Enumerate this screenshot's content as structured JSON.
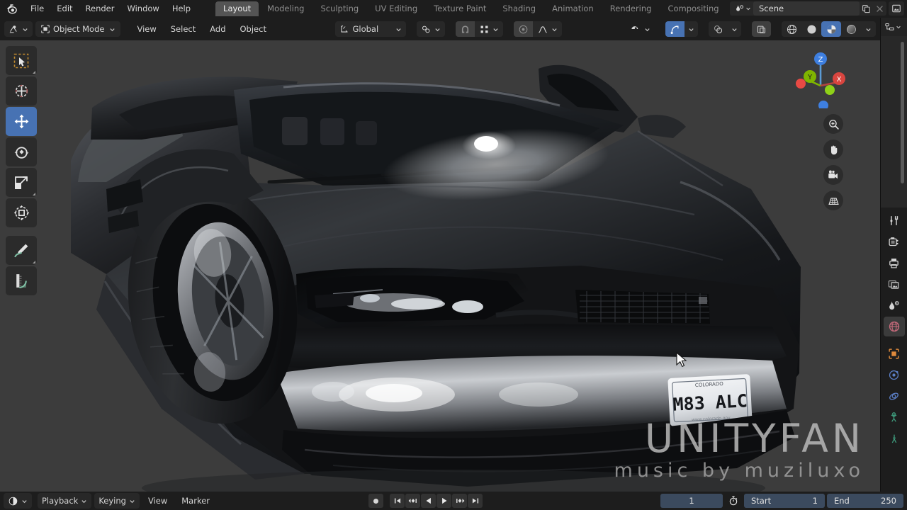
{
  "app": {
    "title": "Blender",
    "logo_icon": "blender-logo-icon"
  },
  "topbar": {
    "menus": [
      {
        "label": "File"
      },
      {
        "label": "Edit"
      },
      {
        "label": "Render"
      },
      {
        "label": "Window"
      },
      {
        "label": "Help"
      }
    ],
    "workspace_tabs": [
      {
        "label": "Layout",
        "active": true
      },
      {
        "label": "Modeling",
        "active": false
      },
      {
        "label": "Sculpting",
        "active": false
      },
      {
        "label": "UV Editing",
        "active": false
      },
      {
        "label": "Texture Paint",
        "active": false
      },
      {
        "label": "Shading",
        "active": false
      },
      {
        "label": "Animation",
        "active": false
      },
      {
        "label": "Rendering",
        "active": false
      },
      {
        "label": "Compositing",
        "active": false
      }
    ],
    "scene": {
      "browse_icon": "scene-browse-icon",
      "name": "Scene",
      "new_icon": "duplicate-icon",
      "unlink_icon": "close-icon",
      "viewlayer_icon": "view-layer-icon"
    }
  },
  "viewport_header": {
    "editor_type_icon": "editor-type-icon",
    "mode": {
      "icon": "object-mode-icon",
      "label": "Object Mode",
      "caret": "chevron-down-icon"
    },
    "menus": [
      {
        "label": "View"
      },
      {
        "label": "Select"
      },
      {
        "label": "Add"
      },
      {
        "label": "Object"
      }
    ],
    "transform_orientation": {
      "icon": "orientation-icon",
      "label": "Global",
      "caret": "chevron-down-icon"
    },
    "pivot": {
      "icon": "pivot-icon",
      "caret": "chevron-down-icon"
    },
    "snap": {
      "icon": "magnet-icon",
      "enabled": false
    },
    "snap_target": {
      "icon": "snap-target-icon",
      "caret": "chevron-down-icon"
    },
    "proportional": {
      "icon": "proportional-edit-icon",
      "enabled": false
    },
    "falloff": {
      "icon": "falloff-curve-icon",
      "caret": "chevron-down-icon"
    },
    "visibility": {
      "icon": "visibility-icon",
      "caret": "chevron-down-icon"
    },
    "gizmos": {
      "icon": "gizmo-icon",
      "enabled": true,
      "caret": "chevron-down-icon"
    },
    "overlays": {
      "icon": "overlays-icon",
      "enabled": false,
      "caret": "chevron-down-icon"
    },
    "xray": {
      "icon": "xray-icon",
      "enabled": false
    },
    "shading_modes": [
      {
        "name": "wireframe",
        "icon": "wireframe-sphere-icon",
        "active": false
      },
      {
        "name": "solid",
        "icon": "solid-sphere-icon",
        "active": false
      },
      {
        "name": "material-preview",
        "icon": "material-sphere-icon",
        "active": true
      },
      {
        "name": "rendered",
        "icon": "rendered-sphere-icon",
        "active": false
      }
    ],
    "shading_caret": "chevron-down-icon"
  },
  "toolbar": {
    "tools": [
      {
        "name": "select-box",
        "icon": "cursor-box-select-icon",
        "active": false,
        "has_submenu": true
      },
      {
        "name": "cursor",
        "icon": "3d-cursor-icon",
        "active": false,
        "has_submenu": false
      },
      {
        "name": "move",
        "icon": "move-arrows-icon",
        "active": true,
        "has_submenu": false
      },
      {
        "name": "rotate",
        "icon": "rotate-icon",
        "active": false,
        "has_submenu": false
      },
      {
        "name": "scale",
        "icon": "scale-icon",
        "active": false,
        "has_submenu": true
      },
      {
        "name": "transform",
        "icon": "transform-icon",
        "active": false,
        "has_submenu": false
      },
      {
        "name": "annotate",
        "icon": "annotate-pencil-icon",
        "active": false,
        "has_submenu": true
      },
      {
        "name": "measure",
        "icon": "measure-ruler-icon",
        "active": false,
        "has_submenu": false
      }
    ]
  },
  "gizmo": {
    "axes": [
      {
        "label": "Z",
        "color": "#3e7fe0"
      },
      {
        "label": "Y",
        "color": "#7fb500"
      },
      {
        "label": "X",
        "color": "#d9453f"
      }
    ],
    "nav_buttons": [
      {
        "name": "zoom",
        "icon": "zoom-magnifier-icon"
      },
      {
        "name": "pan",
        "icon": "hand-pan-icon"
      },
      {
        "name": "camera-view",
        "icon": "camera-icon"
      },
      {
        "name": "toggle-ortho",
        "icon": "grid-perspective-icon"
      }
    ]
  },
  "scene_content": {
    "object": "sports car",
    "license_plate": "M83 ALC",
    "background_color": "#3c3c3c"
  },
  "watermark": {
    "line1": "UNITYFAN",
    "line2": "music  by  muziluxo"
  },
  "outliner": {
    "editor_icon": "outliner-icon",
    "caret": "chevron-down-icon"
  },
  "properties": {
    "tabs": [
      {
        "name": "tool",
        "icon": "tool-wrench-icon",
        "active": false
      },
      {
        "name": "render",
        "icon": "render-camera-icon",
        "active": false
      },
      {
        "name": "output",
        "icon": "output-printer-icon",
        "active": false
      },
      {
        "name": "view-layer",
        "icon": "view-layer-images-icon",
        "active": false
      },
      {
        "name": "scene",
        "icon": "scene-cone-icon",
        "active": false
      },
      {
        "name": "world",
        "icon": "world-globe-icon",
        "active": true
      },
      {
        "name": "object",
        "icon": "object-square-icon",
        "active": false
      },
      {
        "name": "modifiers",
        "icon": "modifier-wrench-icon",
        "active": false
      },
      {
        "name": "physics",
        "icon": "physics-orbit-icon",
        "active": false
      },
      {
        "name": "particles",
        "icon": "particles-icon",
        "active": false
      },
      {
        "name": "constraints",
        "icon": "constraints-icon",
        "active": false
      }
    ]
  },
  "timeline": {
    "editor_icon": "timeline-editor-icon",
    "caret": "chevron-down-icon",
    "menus": [
      {
        "label": "Playback",
        "has_caret": true
      },
      {
        "label": "Keying",
        "has_caret": true
      },
      {
        "label": "View",
        "has_caret": false
      },
      {
        "label": "Marker",
        "has_caret": false
      }
    ],
    "controls": [
      {
        "name": "record-keyframes",
        "icon": "record-circle-icon"
      },
      {
        "name": "jump-to-start",
        "icon": "jump-start-icon"
      },
      {
        "name": "previous-keyframe",
        "icon": "prev-keyframe-icon"
      },
      {
        "name": "play-reverse",
        "icon": "play-reverse-icon"
      },
      {
        "name": "play",
        "icon": "play-icon"
      },
      {
        "name": "next-keyframe",
        "icon": "next-keyframe-icon"
      },
      {
        "name": "jump-to-end",
        "icon": "jump-end-icon"
      }
    ],
    "current_frame": "1",
    "auto_key_icon": "stopwatch-icon",
    "start_label": "Start",
    "start_value": "1",
    "end_label": "End",
    "end_value": "250"
  }
}
